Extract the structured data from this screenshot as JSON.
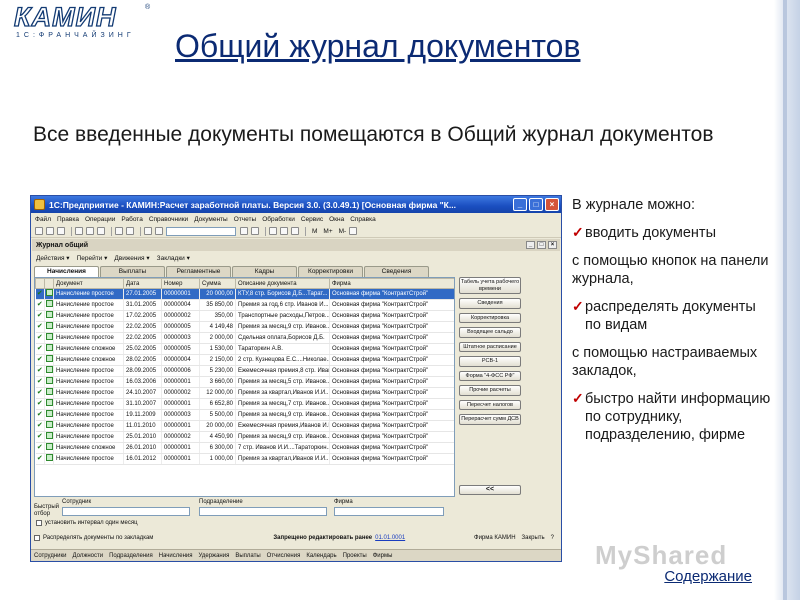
{
  "slide": {
    "logo_text": "КАМИН",
    "logo_reg": "®",
    "logo_subtitle": "1С:ФРАНЧАЙЗИНГ",
    "title": "Общий журнал документов",
    "intro": "Все введенные документы помещаются в Общий журнал документов",
    "right_lines": [
      {
        "text": "В  журнале можно:",
        "check": false
      },
      {
        "text": "вводить документы",
        "check": true
      },
      {
        "text": "с помощью кнопок на панели журнала,",
        "check": false
      },
      {
        "text": "распределять документы по видам",
        "check": true
      },
      {
        "text": "с помощью настраиваемых закладок,",
        "check": false
      },
      {
        "text": "быстро  найти информацию по сотруднику, подразделению, фирме",
        "check": true
      }
    ],
    "toc_link": "Содержание",
    "watermark": "MyShared"
  },
  "window": {
    "title": "1С:Предприятие - КАМИН:Расчет заработной платы. Версия 3.0. (3.0.49.1) [Основная фирма \"К...",
    "menu": [
      "Файл",
      "Правка",
      "Операции",
      "Работа",
      "Справочники",
      "Документы",
      "Отчеты",
      "Обработки",
      "Сервис",
      "Окна",
      "Справка"
    ],
    "toolbar_texts": [
      "M",
      "M+",
      "M-"
    ],
    "subwindow_title": "Журнал общий",
    "actions": [
      "Действия ▾",
      "Перейти ▾",
      "Движения ▾",
      "Закладки ▾"
    ],
    "tabs": [
      {
        "label": "Начисления",
        "active": true
      },
      {
        "label": "Выплаты",
        "active": false
      },
      {
        "label": "Регламентные",
        "active": false
      },
      {
        "label": "Кадры",
        "active": false
      },
      {
        "label": "Корректировки",
        "active": false
      },
      {
        "label": "Сведения",
        "active": false
      }
    ],
    "columns": [
      "Документ",
      "Дата",
      "Номер",
      "Сумма",
      "Описание документа",
      "Фирма"
    ],
    "rows": [
      {
        "doc": "Начисление простое",
        "date": "27.01.2005",
        "num": "00000001",
        "sum": "20 000,00",
        "desc": "КТУ,8 стр. Борисов Д.Б...Тарат...",
        "firm": "Основная фирма \"КонтрактСтрой\"",
        "selected": true
      },
      {
        "doc": "Начисление простое",
        "date": "31.01.2005",
        "num": "00000004",
        "sum": "35 850,00",
        "desc": "Премия за год,6 стр. Иванов И...",
        "firm": "Основная фирма \"КонтрактСтрой\"",
        "selected": false
      },
      {
        "doc": "Начисление простое",
        "date": "17.02.2005",
        "num": "00000002",
        "sum": "350,00",
        "desc": "Транспортные расходы,Петров...",
        "firm": "Основная фирма \"КонтрактСтрой\"",
        "selected": false
      },
      {
        "doc": "Начисление простое",
        "date": "22.02.2005",
        "num": "00000005",
        "sum": "4 149,48",
        "desc": "Премия за месяц,9 стр. Иванов...",
        "firm": "Основная фирма \"КонтрактСтрой\"",
        "selected": false
      },
      {
        "doc": "Начисление простое",
        "date": "22.02.2005",
        "num": "00000003",
        "sum": "2 000,00",
        "desc": "Сдельная оплата,Борисов Д.Б.",
        "firm": "Основная фирма \"КонтрактСтрой\"",
        "selected": false
      },
      {
        "doc": "Начисление сложное",
        "date": "25.02.2005",
        "num": "00000005",
        "sum": "1 530,00",
        "desc": "Тараторкин А.В.",
        "firm": "Основная фирма \"КонтрактСтрой\"",
        "selected": false
      },
      {
        "doc": "Начисление сложное",
        "date": "28.02.2005",
        "num": "00000004",
        "sum": "2 150,00",
        "desc": "2 стр. Кузнецова Е.С....Николае...",
        "firm": "Основная фирма \"КонтрактСтрой\"",
        "selected": false
      },
      {
        "doc": "Начисление простое",
        "date": "28.09.2005",
        "num": "00000006",
        "sum": "5 230,00",
        "desc": "Ежемесячная премия,8 стр. Иван...",
        "firm": "Основная фирма \"КонтрактСтрой\"",
        "selected": false
      },
      {
        "doc": "Начисление простое",
        "date": "16.03.2006",
        "num": "00000001",
        "sum": "3 660,00",
        "desc": "Премия за месяц,5 стр. Иванов...",
        "firm": "Основная фирма \"КонтрактСтрой\"",
        "selected": false
      },
      {
        "doc": "Начисление простое",
        "date": "24.10.2007",
        "num": "00000002",
        "sum": "12 000,00",
        "desc": "Премия за квартал,Иванов И.И....",
        "firm": "Основная фирма \"КонтрактСтрой\"",
        "selected": false
      },
      {
        "doc": "Начисление простое",
        "date": "31.10.2007",
        "num": "00000001",
        "sum": "6 652,80",
        "desc": "Премия за месяц,7 стр. Иванов...",
        "firm": "Основная фирма \"КонтрактСтрой\"",
        "selected": false
      },
      {
        "doc": "Начисление простое",
        "date": "19.11.2009",
        "num": "00000003",
        "sum": "5 500,00",
        "desc": "Премия за месяц,9 стр. Иванов...",
        "firm": "Основная фирма \"КонтрактСтрой\"",
        "selected": false
      },
      {
        "doc": "Начисление простое",
        "date": "11.01.2010",
        "num": "00000001",
        "sum": "20 000,00",
        "desc": "Ежемесячная премия,Иванов И.И...",
        "firm": "Основная фирма \"КонтрактСтрой\"",
        "selected": false
      },
      {
        "doc": "Начисление простое",
        "date": "25.01.2010",
        "num": "00000002",
        "sum": "4 450,90",
        "desc": "Премия за месяц,9 стр. Иванов...",
        "firm": "Основная фирма \"КонтрактСтрой\"",
        "selected": false
      },
      {
        "doc": "Начисление сложное",
        "date": "26.01.2010",
        "num": "00000001",
        "sum": "6 300,00",
        "desc": "7 стр. Иванов И.И....Тараторкин...",
        "firm": "Основная фирма \"КонтрактСтрой\"",
        "selected": false
      },
      {
        "doc": "Начисление простое",
        "date": "16.01.2012",
        "num": "00000001",
        "sum": "1 000,00",
        "desc": "Премия за квартал,Иванов И.И....",
        "firm": "Основная фирма \"КонтрактСтрой\"",
        "selected": false
      }
    ],
    "side_buttons": [
      "Табель учета рабочего времени",
      "Сведения",
      "Корректировка",
      "Входящее сальдо",
      "Штатное расписание",
      "РСВ-1",
      "Форма \"4-ФСС РФ\"",
      "Прочие расчеты",
      "Пересчет налогов",
      "Перерасчет сумм ДСВ"
    ],
    "collapse_button": "<<",
    "filters": {
      "quick_filter": "Быстрый отбор",
      "employee": "Сотрудник",
      "department": "Подразделение",
      "firm": "Фирма",
      "interval": "установить интервал один месяц"
    },
    "bottom": {
      "distribute": "Распределять документы по закладкам",
      "saved_label": "Запрещено редактировать ранее",
      "saved_date": "01.01.0001",
      "right": [
        "Фирма КАМИН",
        "Закрыть",
        "?"
      ]
    },
    "taskbar": [
      "Сотрудники",
      "Должности",
      "Подразделения",
      "Начисления",
      "Удержания",
      "Выплаты",
      "Отчисления",
      "Календарь",
      "Проекты",
      "Фирмы"
    ]
  }
}
